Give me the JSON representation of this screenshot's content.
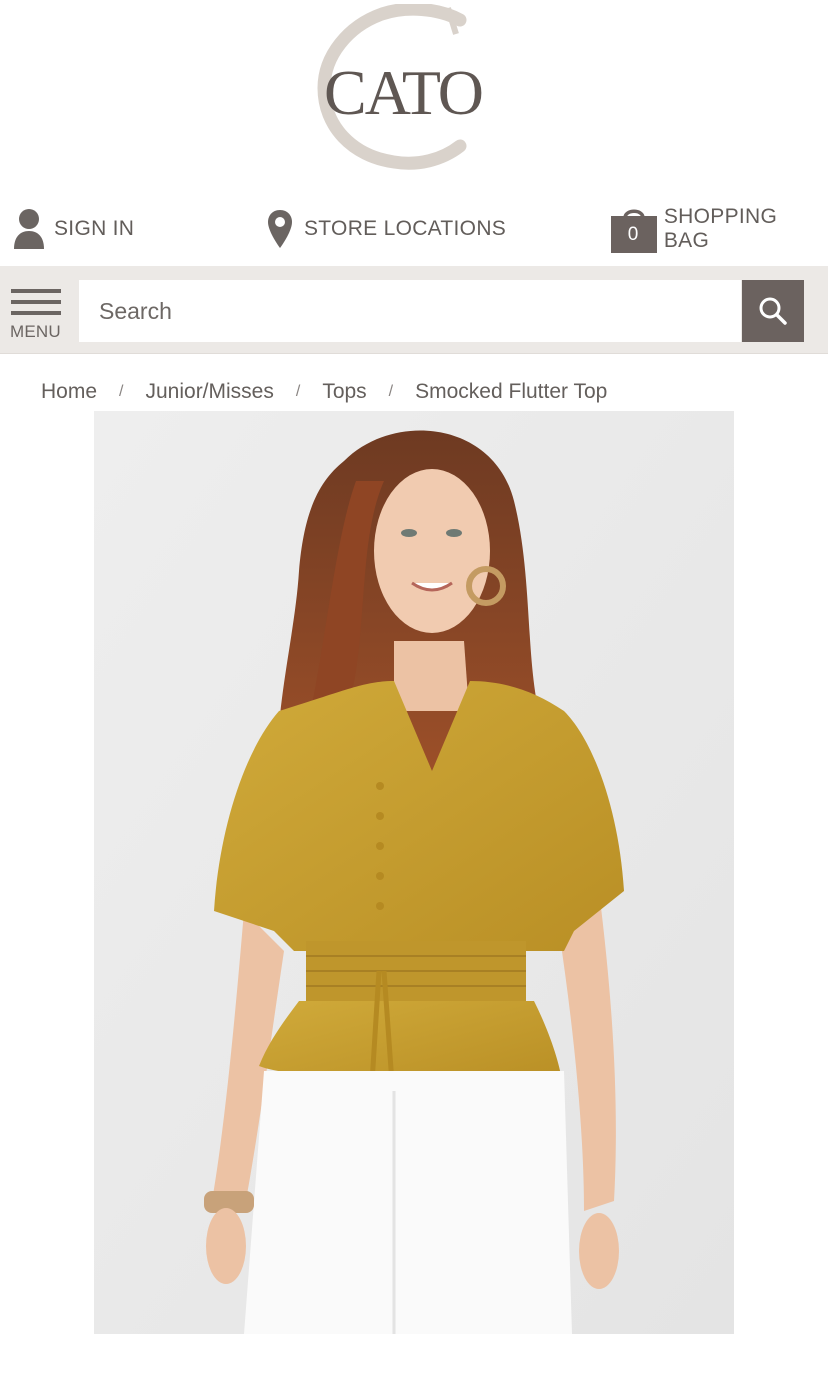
{
  "brand": {
    "name": "CATO",
    "colors": {
      "logo_text": "#5f5753",
      "logo_c": "#d8d1ca"
    }
  },
  "utility_nav": {
    "sign_in": {
      "label": "SIGN IN",
      "icon": "user-icon"
    },
    "store_locations": {
      "label": "STORE LOCATIONS",
      "icon": "map-pin-icon"
    },
    "shopping_bag": {
      "label": "SHOPPING BAG",
      "count": "0",
      "icon": "shopping-bag-icon"
    }
  },
  "search": {
    "menu_label": "MENU",
    "placeholder": "Search",
    "button_icon": "search-icon"
  },
  "breadcrumb": {
    "items": [
      "Home",
      "Junior/Misses",
      "Tops",
      "Smocked Flutter Top"
    ],
    "separator": "/"
  },
  "colors": {
    "accent_dark": "#6b625f",
    "strip_bg": "#ece9e6",
    "product_top": "#c9a12f"
  }
}
